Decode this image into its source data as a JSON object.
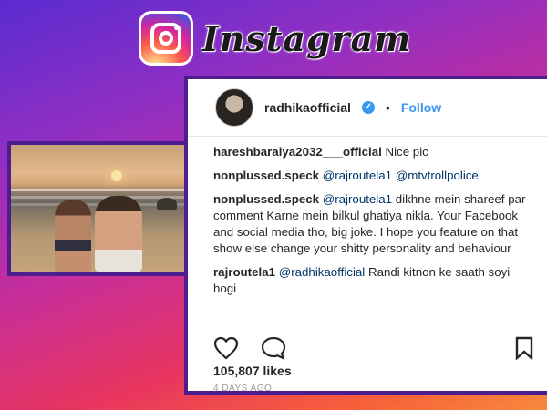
{
  "brand": {
    "wordmark": "Instagram",
    "icon": "instagram-logo-icon"
  },
  "post": {
    "header": {
      "username": "radhikaofficial",
      "verified_icon": "verified-badge-icon",
      "separator": "•",
      "follow_label": "Follow"
    },
    "comments": [
      {
        "user": "hareshbaraiya2032___official",
        "text": "Nice pic"
      },
      {
        "user": "nonplussed.speck",
        "mentions": "@rajroutela1 @mtvtrollpolice",
        "text": ""
      },
      {
        "user": "nonplussed.speck",
        "mentions": "@rajroutela1",
        "text": "dikhne mein shareef par comment Karne mein bilkul ghatiya nikla. Your Facebook and social media tho, big joke. I hope you feature on that show else change your shitty personality and behaviour"
      },
      {
        "user": "rajroutela1",
        "mentions": "@radhikaofficial",
        "text": "Randi kitnon ke saath soyi hogi"
      }
    ],
    "actions": {
      "like_icon": "heart-icon",
      "comment_icon": "comment-bubble-icon",
      "save_icon": "bookmark-icon"
    },
    "likes": "105,807 likes",
    "timestamp": "4 DAYS AGO"
  },
  "colors": {
    "link_blue": "#3897f0",
    "card_border": "#4b1d8e"
  }
}
